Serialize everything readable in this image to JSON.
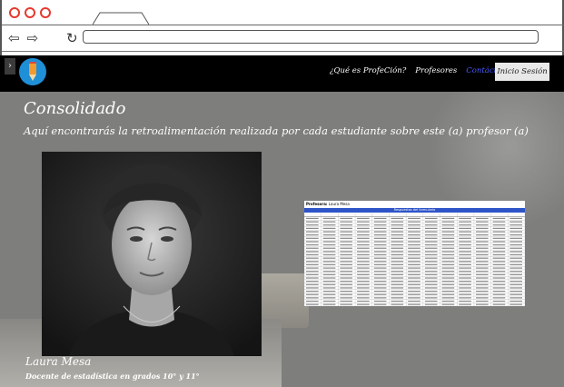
{
  "browser": {
    "back_icon": "back-arrow-icon",
    "forward_icon": "forward-arrow-icon",
    "reload_icon": "reload-icon",
    "url": ""
  },
  "navbar": {
    "logo_icon": "pencil-logo-icon",
    "menu": [
      {
        "label": "¿Qué es ProfeCión?"
      },
      {
        "label": "Profesores"
      },
      {
        "label": "Contáctanos"
      }
    ],
    "login_label": "Inicio Sesión",
    "colors": {
      "background": "#000000",
      "active_link": "#4a5bff"
    }
  },
  "main": {
    "title": "Consolidado",
    "subtitle": "Aquí encontrarás la retroalimentación realizada por cada estudiante sobre este (a) profesor (a)",
    "teacher_name": "Laura Mesa",
    "teacher_role": "Docente de estadística en grados 10° y 11°"
  },
  "sheet": {
    "header_prefix": "Profesora:",
    "header_name": "Laura Mesa",
    "band_title": "Respuestas del formulario"
  }
}
